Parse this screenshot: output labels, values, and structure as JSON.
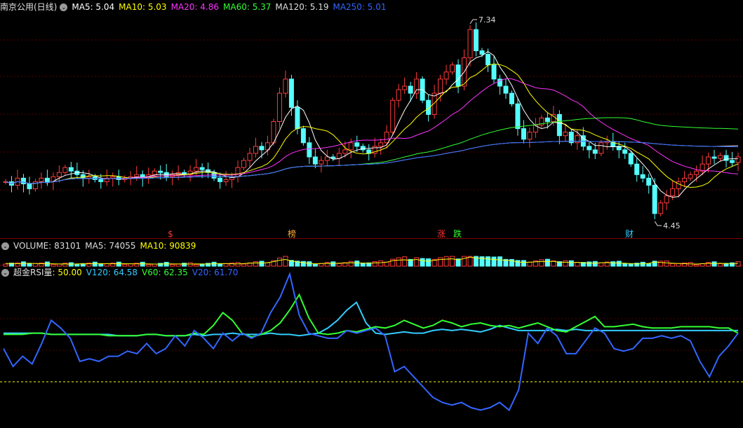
{
  "main": {
    "title": "南京公用(日线)",
    "ma": [
      {
        "label": "MA5: 5.04",
        "color": "#ffffff"
      },
      {
        "label": "MA10: 5.03",
        "color": "#ffff00"
      },
      {
        "label": "MA20: 4.86",
        "color": "#ff33ff"
      },
      {
        "label": "MA60: 5.37",
        "color": "#33ff33"
      },
      {
        "label": "MA120: 5.19",
        "color": "#dddddd"
      },
      {
        "label": "MA250: 5.01",
        "color": "#3366ff"
      }
    ],
    "high_label": "7.34",
    "low_label": "4.45",
    "markers": [
      {
        "text": "$",
        "color": "#ff3333",
        "x": 243
      },
      {
        "text": "榜",
        "color": "#ffaa33",
        "x": 416
      },
      {
        "text": "涨",
        "color": "#ff3333",
        "x": 629
      },
      {
        "text": "跌",
        "color": "#33ff33",
        "x": 652
      },
      {
        "text": "财",
        "color": "#33ccff",
        "x": 897
      }
    ]
  },
  "volume": {
    "labels": [
      {
        "label": "VOLUME: 83101",
        "color": "#dddddd"
      },
      {
        "label": "MA5: 74055",
        "color": "#dddddd"
      },
      {
        "label": "MA10: 90839",
        "color": "#ffff00"
      }
    ]
  },
  "rsi": {
    "title": "超金RSI量",
    "labels": [
      {
        "label": ": 50.00",
        "color": "#ffff00"
      },
      {
        "label": "V120: 64.58",
        "color": "#33ccff"
      },
      {
        "label": "V60: 62.35",
        "color": "#33ff33"
      },
      {
        "label": "V20: 61.70",
        "color": "#3366ff"
      }
    ]
  },
  "chart_data": [
    {
      "type": "candlestick",
      "title": "南京公用(日线)",
      "price_range": [
        4.45,
        7.34
      ],
      "closes": [
        5.05,
        5.0,
        5.1,
        5.02,
        4.95,
        5.05,
        5.1,
        5.05,
        5.12,
        5.18,
        5.25,
        5.2,
        5.15,
        5.1,
        5.12,
        5.08,
        5.05,
        5.1,
        5.12,
        5.08,
        5.1,
        5.12,
        5.15,
        5.1,
        5.15,
        5.2,
        5.18,
        5.12,
        5.15,
        5.18,
        5.15,
        5.2,
        5.25,
        5.22,
        5.18,
        5.1,
        5.05,
        5.08,
        5.12,
        5.25,
        5.35,
        5.45,
        5.55,
        5.5,
        5.6,
        5.9,
        6.3,
        6.5,
        6.1,
        5.8,
        5.6,
        5.4,
        5.3,
        5.35,
        5.4,
        5.38,
        5.45,
        5.5,
        5.6,
        5.55,
        5.5,
        5.45,
        5.55,
        5.6,
        5.75,
        6.2,
        6.35,
        6.4,
        6.3,
        6.5,
        6.2,
        6.0,
        6.3,
        6.5,
        6.6,
        6.7,
        6.4,
        6.8,
        7.2,
        6.9,
        6.85,
        6.7,
        6.5,
        6.4,
        6.3,
        6.15,
        5.8,
        5.65,
        5.75,
        5.85,
        5.95,
        5.9,
        6.0,
        5.7,
        5.75,
        5.6,
        5.7,
        5.55,
        5.5,
        5.45,
        5.6,
        5.62,
        5.55,
        5.5,
        5.45,
        5.3,
        5.15,
        5.1,
        5.0,
        4.6,
        4.75,
        4.85,
        4.95,
        5.05,
        5.1,
        5.15,
        5.2,
        5.3,
        5.4,
        5.38,
        5.42,
        5.35,
        5.32,
        5.4
      ],
      "ma_series": [
        "MA5",
        "MA10",
        "MA20",
        "MA60",
        "MA120",
        "MA250"
      ]
    },
    {
      "type": "bar",
      "title": "VOLUME",
      "series": [
        {
          "name": "VOLUME",
          "values": [
            83101
          ]
        },
        {
          "name": "MA5",
          "values": [
            74055
          ]
        },
        {
          "name": "MA10",
          "values": [
            90839
          ]
        }
      ]
    },
    {
      "type": "line",
      "title": "超金RSI量",
      "reference": 50.0,
      "ylim": [
        0,
        100
      ],
      "series": [
        {
          "name": "V120",
          "values": [
            62,
            62,
            62,
            62,
            62,
            61,
            61,
            61,
            61,
            61,
            61,
            61,
            60,
            60,
            60,
            61,
            61,
            60,
            60,
            60,
            61,
            60,
            61,
            61,
            62,
            61,
            61,
            61,
            62,
            61,
            61,
            60,
            61,
            62,
            66,
            72,
            80,
            86,
            70,
            62,
            61,
            62,
            63,
            62,
            62,
            64,
            65,
            64,
            65,
            64,
            63,
            65,
            68,
            66,
            64,
            64,
            64,
            64,
            65,
            64,
            65,
            64,
            64,
            64,
            64,
            64,
            64,
            64,
            64,
            64,
            64,
            64,
            64,
            64,
            64,
            64,
            64,
            64
          ]
        },
        {
          "name": "V60",
          "values": [
            61,
            61,
            61,
            62,
            62,
            61,
            61,
            61,
            61,
            61,
            61,
            60,
            60,
            60,
            60,
            61,
            61,
            60,
            60,
            60,
            62,
            61,
            68,
            78,
            72,
            62,
            59,
            61,
            64,
            70,
            80,
            92,
            74,
            62,
            61,
            62,
            64,
            63,
            65,
            67,
            66,
            68,
            72,
            69,
            66,
            68,
            72,
            70,
            67,
            69,
            70,
            68,
            67,
            68,
            66,
            68,
            70,
            67,
            64,
            63,
            67,
            71,
            75,
            67,
            67,
            68,
            69,
            67,
            66,
            66,
            66,
            67,
            67,
            67,
            67,
            66,
            66,
            62
          ]
        },
        {
          "name": "V20",
          "values": [
            50,
            36,
            44,
            38,
            54,
            72,
            66,
            58,
            40,
            42,
            40,
            44,
            44,
            48,
            46,
            54,
            46,
            50,
            60,
            52,
            64,
            58,
            50,
            62,
            56,
            62,
            58,
            62,
            78,
            90,
            108,
            76,
            62,
            60,
            58,
            58,
            64,
            62,
            64,
            66,
            60,
            32,
            36,
            28,
            20,
            12,
            8,
            6,
            8,
            4,
            2,
            4,
            8,
            2,
            18,
            62,
            54,
            66,
            60,
            46,
            46,
            56,
            66,
            62,
            50,
            48,
            50,
            58,
            58,
            60,
            58,
            60,
            56,
            40,
            28,
            44,
            52,
            62
          ]
        }
      ]
    }
  ]
}
